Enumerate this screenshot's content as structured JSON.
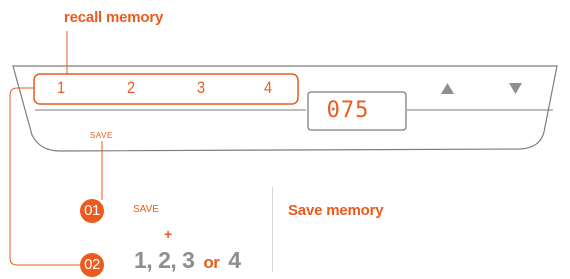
{
  "colors": {
    "accent": "#ec5a1e",
    "outline": "#7d7d7d",
    "key_gray": "#8e8e8e",
    "divider": "#d6d6d6"
  },
  "recall_memory": {
    "title": "recall memory"
  },
  "keypad": {
    "memory_keys": [
      "1",
      "2",
      "3",
      "4"
    ],
    "save_label": "SAVE",
    "display_value": "075",
    "up_icon": "triangle-up-icon",
    "down_icon": "triangle-down-icon"
  },
  "steps": [
    {
      "number": "01",
      "text": "SAVE"
    },
    {
      "number": "02",
      "plus": "+",
      "keys": "1, 2, 3",
      "or": "or",
      "last_key": "4"
    }
  ],
  "save_memory": {
    "title": "Save memory"
  }
}
